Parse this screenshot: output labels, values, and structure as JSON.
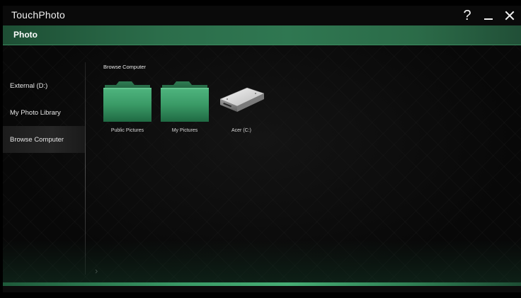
{
  "app": {
    "title": "TouchPhoto",
    "help_glyph": "?",
    "minimize_icon": "minimize-icon",
    "close_icon": "close-icon"
  },
  "header": {
    "title": "Photo"
  },
  "sidebar": {
    "items": [
      {
        "label": "External (D:)"
      },
      {
        "label": "My Photo Library"
      },
      {
        "label": "Browse Computer",
        "selected": true
      }
    ],
    "next_arrow": "›"
  },
  "main": {
    "section_title": "Browse Computer",
    "tiles": [
      {
        "label": "Public Pictures",
        "icon": "folder-icon"
      },
      {
        "label": "My Pictures",
        "icon": "folder-icon"
      },
      {
        "label": "Acer (C:)",
        "icon": "hard-drive-icon"
      }
    ]
  },
  "colors": {
    "accent_green": "#2f7751",
    "folder_green": "#3a9a66",
    "background": "#080808"
  }
}
